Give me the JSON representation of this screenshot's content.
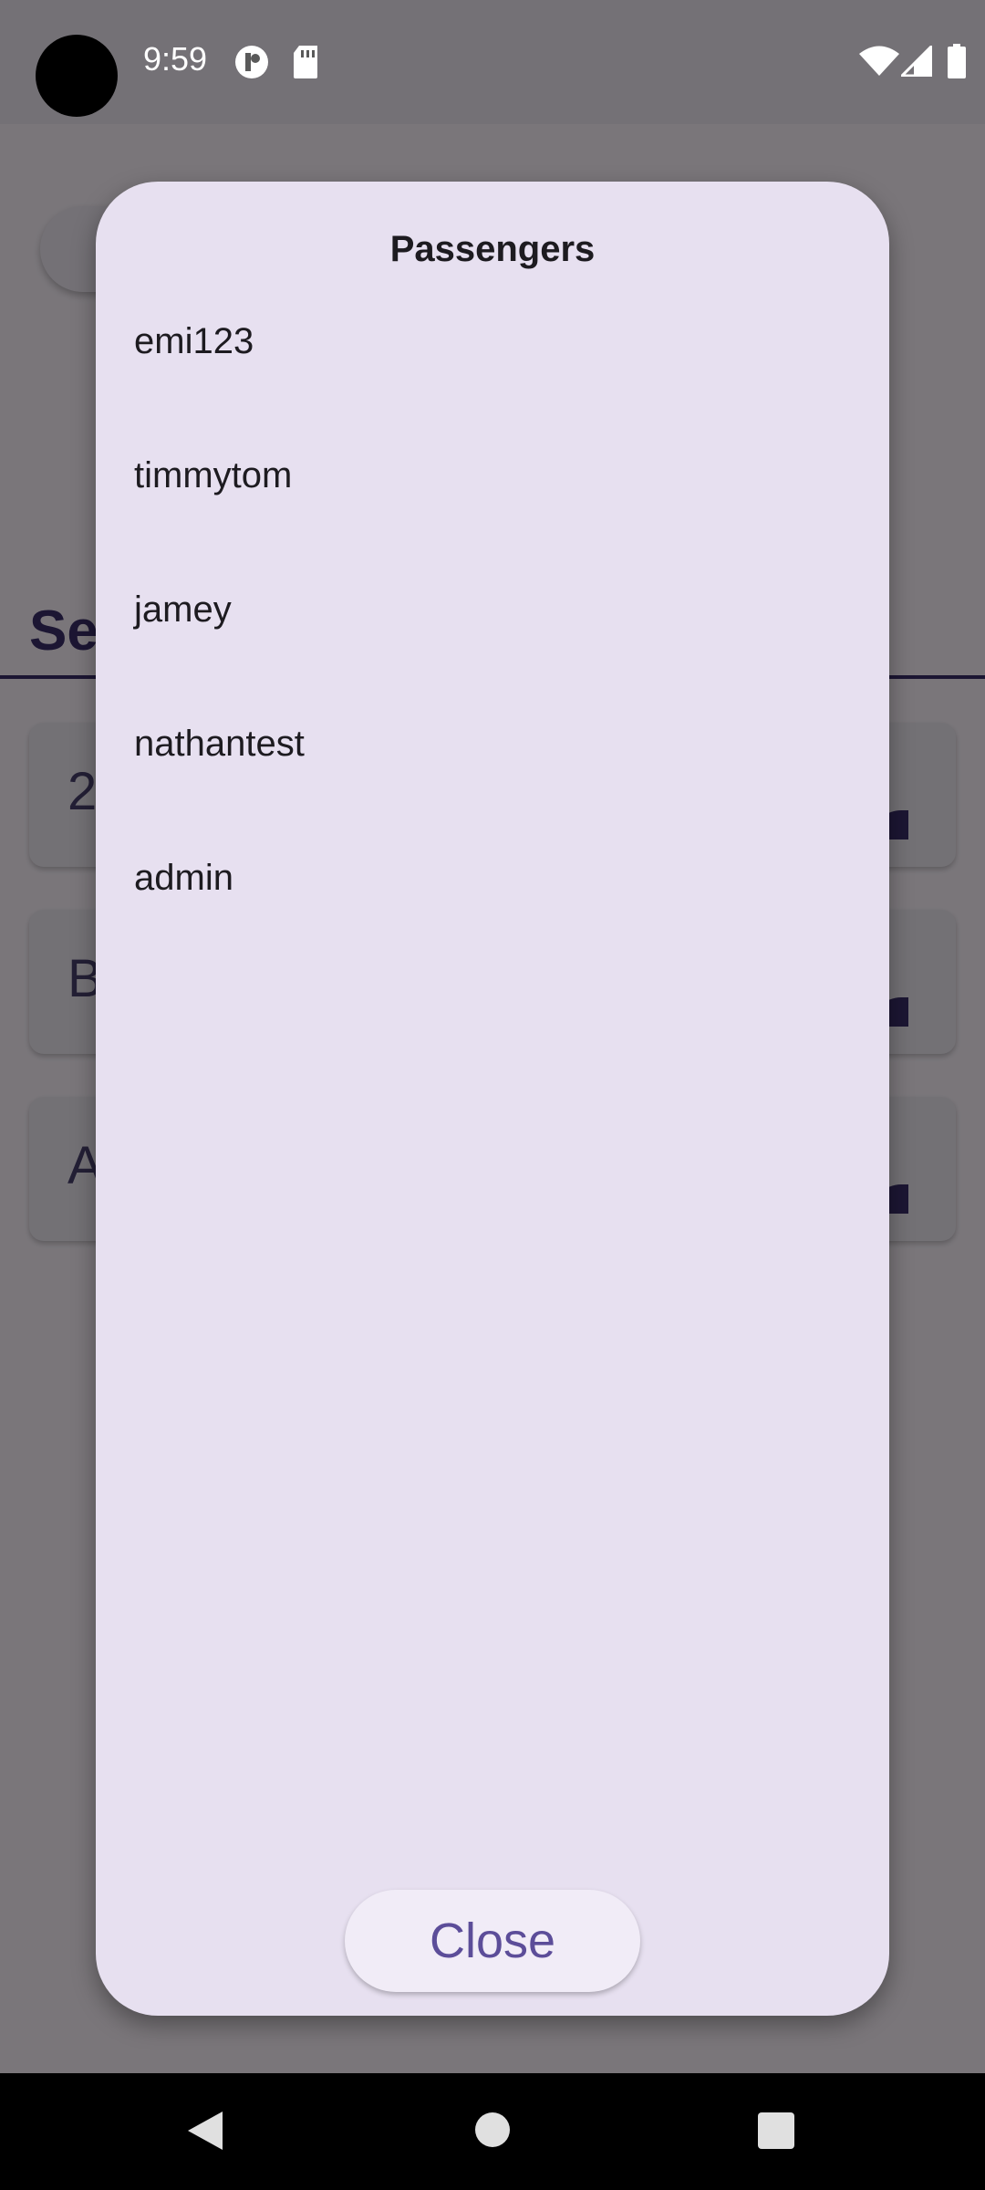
{
  "status_bar": {
    "time": "9:59",
    "left_icons": [
      "badge-icon",
      "sd-card-icon"
    ],
    "right_icons": [
      "wifi-icon",
      "signal-icon",
      "battery-icon"
    ]
  },
  "background": {
    "heading_fragment": "Se",
    "cards": [
      {
        "text_fragment": "2"
      },
      {
        "text_fragment": "B"
      },
      {
        "text_fragment": "A"
      }
    ]
  },
  "dialog": {
    "title": "Passengers",
    "passengers": [
      "emi123",
      "timmytom",
      "jamey",
      "nathantest",
      "admin"
    ],
    "close_label": "Close"
  },
  "nav_bar": {
    "icons": [
      "back-icon",
      "home-icon",
      "recents-icon"
    ]
  },
  "colors": {
    "dialog_bg": "#e7e0f0",
    "accent": "#5c4d99",
    "text": "#1d1b20"
  }
}
